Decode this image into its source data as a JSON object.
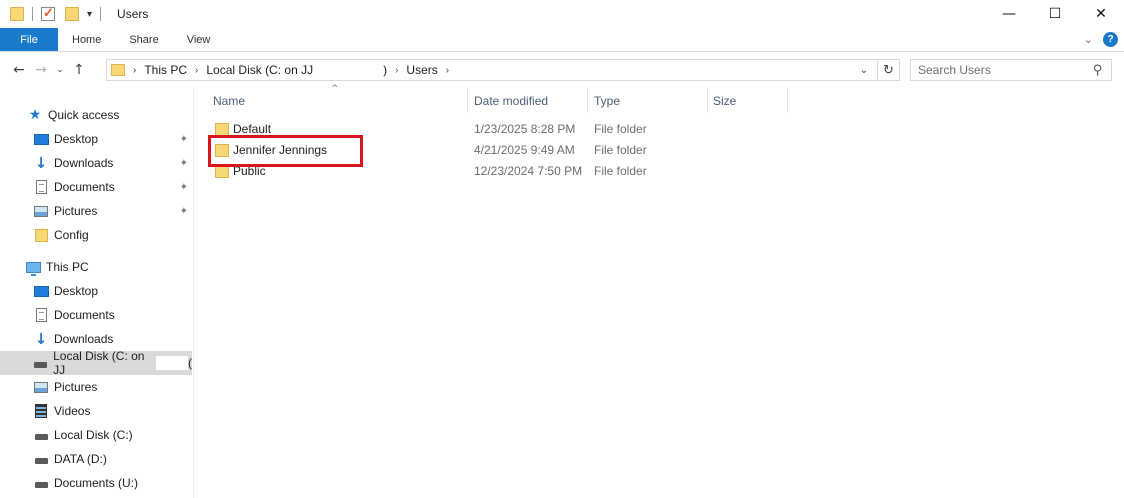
{
  "window": {
    "title": "Users",
    "minimize": "—",
    "maximize": "☐",
    "close": "✕"
  },
  "ribbon": {
    "tabs": [
      "File",
      "Home",
      "Share",
      "View"
    ],
    "expand": "⌄",
    "help": "?"
  },
  "nav": {
    "back": "←",
    "forward": "→",
    "recent": "⌄",
    "up": "↑"
  },
  "address": {
    "crumbs": [
      "This PC",
      "Local Disk (C: on JJ",
      ")",
      "Users"
    ],
    "dropdown": "⌄",
    "refresh": "↻"
  },
  "search": {
    "placeholder": "Search Users"
  },
  "navpane": {
    "quick_access": {
      "label": "Quick access",
      "items": [
        {
          "label": "Desktop",
          "icon": "desktop-icon",
          "pinned": true
        },
        {
          "label": "Downloads",
          "icon": "downloads-icon",
          "pinned": true
        },
        {
          "label": "Documents",
          "icon": "documents-icon",
          "pinned": true
        },
        {
          "label": "Pictures",
          "icon": "pictures-icon",
          "pinned": true
        },
        {
          "label": "Config",
          "icon": "folder-icon",
          "pinned": false
        }
      ]
    },
    "this_pc": {
      "label": "This PC",
      "items": [
        {
          "label": "Desktop",
          "icon": "desktop-icon"
        },
        {
          "label": "Documents",
          "icon": "documents-icon"
        },
        {
          "label": "Downloads",
          "icon": "downloads-icon"
        },
        {
          "label": "Local Disk (C: on JJ",
          "trail": "(",
          "icon": "drive-icon",
          "selected": true
        },
        {
          "label": "Pictures",
          "icon": "pictures-icon"
        },
        {
          "label": "Videos",
          "icon": "videos-icon"
        },
        {
          "label": "Local Disk (C:)",
          "icon": "drive-icon"
        },
        {
          "label": "DATA (D:)",
          "icon": "drive-icon"
        },
        {
          "label": "Documents (U:)",
          "icon": "drive-icon"
        }
      ]
    },
    "pin_glyph": "📌"
  },
  "columns": {
    "name": "Name",
    "date": "Date modified",
    "type": "Type",
    "size": "Size",
    "sort_arrow": "^"
  },
  "files": [
    {
      "name": "Default",
      "date": "1/23/2025 8:28 PM",
      "type": "File folder"
    },
    {
      "name": "Jennifer Jennings",
      "date": "4/21/2025 9:49 AM",
      "type": "File folder"
    },
    {
      "name": "Public",
      "date": "12/23/2024 7:50 PM",
      "type": "File folder"
    }
  ],
  "colors": {
    "accent": "#1979ca",
    "highlight": "#d8141c",
    "selected_bg": "#d9d9d9"
  }
}
